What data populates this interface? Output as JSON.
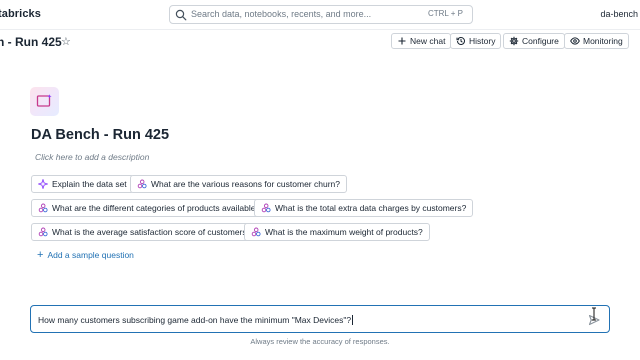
{
  "topbar": {
    "brand": "tabricks",
    "search_placeholder": "Search data, notebooks, recents, and more...",
    "search_shortcut": "CTRL + P",
    "user_label": "da-bench"
  },
  "header": {
    "title": "h - Run 425",
    "buttons": [
      {
        "label": "New chat",
        "icon": "plus-icon"
      },
      {
        "label": "History",
        "icon": "history-icon"
      },
      {
        "label": "Configure",
        "icon": "gear-icon"
      },
      {
        "label": "Monitoring",
        "icon": "eye-icon"
      }
    ]
  },
  "space": {
    "title": "DA Bench - Run 425",
    "description_placeholder": "Click here to add a description",
    "suggestions": [
      {
        "label": "Explain the data set",
        "icon": "sparkle-icon"
      },
      {
        "label": "What are the various reasons for customer churn?",
        "icon": "sample-question-icon"
      },
      {
        "label": "What are the different categories of products available?",
        "icon": "sample-question-icon"
      },
      {
        "label": "What is the total extra data charges by customers?",
        "icon": "sample-question-icon"
      },
      {
        "label": "What is the average satisfaction score of customers?",
        "icon": "sample-question-icon"
      },
      {
        "label": "What is the maximum weight of products?",
        "icon": "sample-question-icon"
      }
    ],
    "add_sample_label": "Add a sample question"
  },
  "chat": {
    "input_value": "How many customers subscribing game add-on have the minimum \"Max Devices\"?",
    "disclaimer": "Always review the accuracy of responses."
  },
  "colors": {
    "accent": "#2272b4",
    "border": "#cfd4da",
    "text": "#1b2633",
    "muted": "#6f7b87",
    "sparkle": "#8a3ffc",
    "question_icon": "#b03fb6"
  }
}
